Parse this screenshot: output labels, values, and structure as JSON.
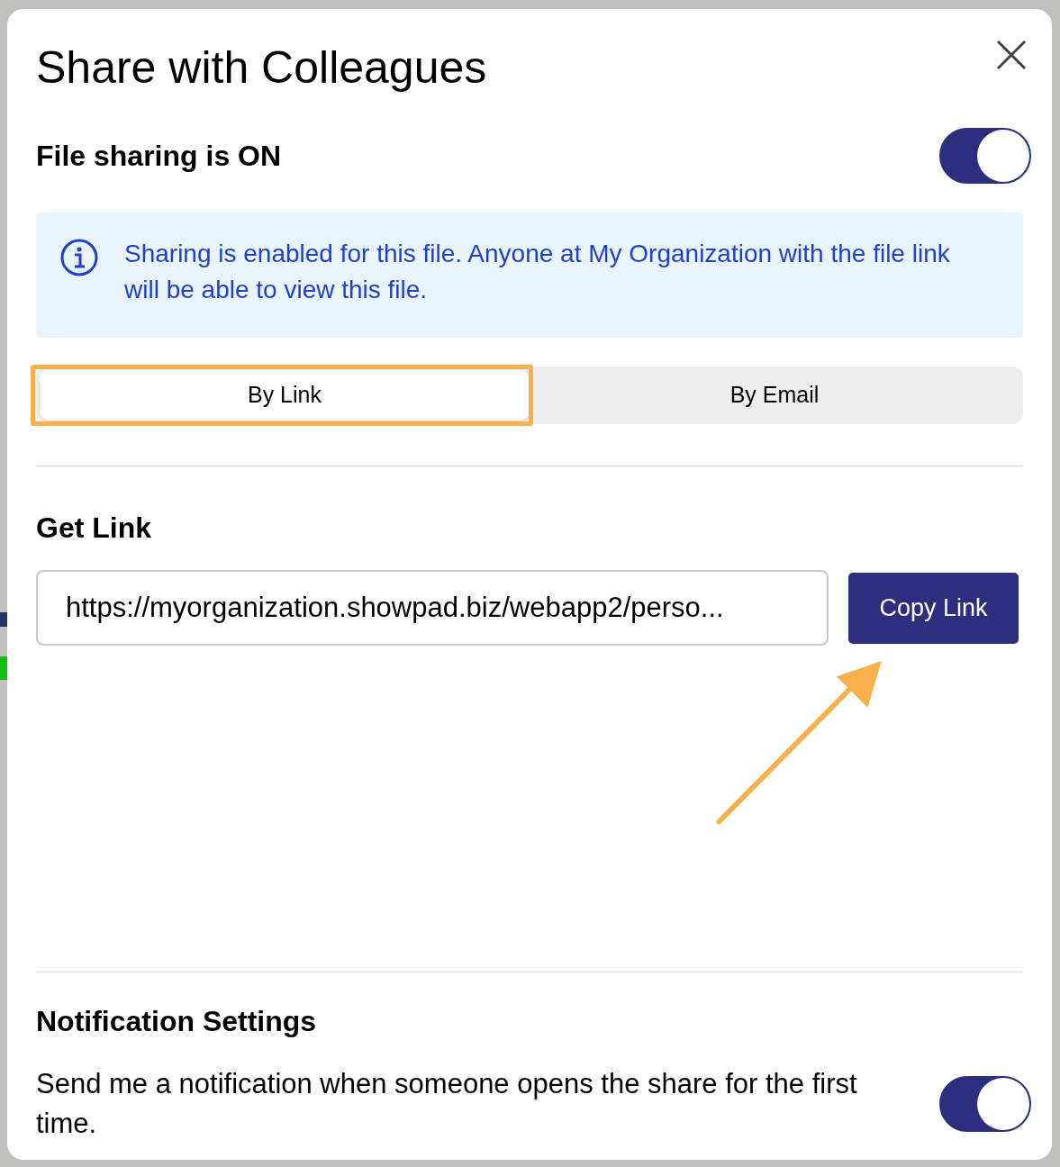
{
  "dialog": {
    "title": "Share with Colleagues"
  },
  "sharing": {
    "label": "File sharing is ON",
    "on": true
  },
  "info": {
    "text": "Sharing is enabled for this file. Anyone at My Organization with the file link will be able to view this file."
  },
  "tabs": [
    {
      "label": "By Link",
      "selected": true,
      "highlighted": true
    },
    {
      "label": "By Email",
      "selected": false,
      "highlighted": false
    }
  ],
  "get_link": {
    "heading": "Get Link",
    "value": "https://myorganization.showpad.biz/webapp2/perso...",
    "button": "Copy Link"
  },
  "notifications": {
    "heading": "Notification Settings",
    "text": "Send me a notification when someone opens the share for the first time.",
    "on": true
  }
}
